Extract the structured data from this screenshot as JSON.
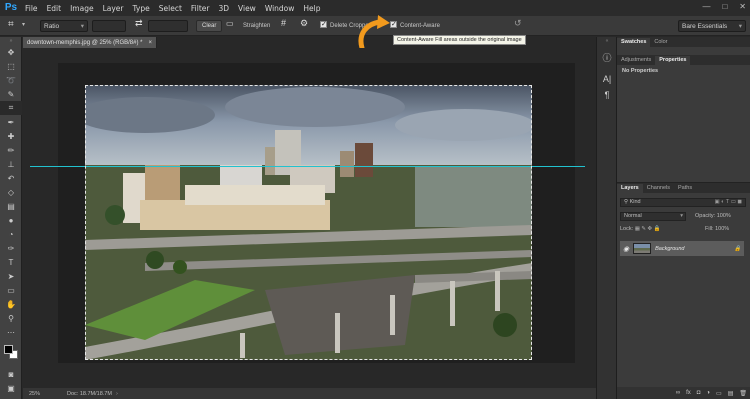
{
  "app": {
    "logo_text": "Ps"
  },
  "menu": [
    "File",
    "Edit",
    "Image",
    "Layer",
    "Type",
    "Select",
    "Filter",
    "3D",
    "View",
    "Window",
    "Help"
  ],
  "options": {
    "ratio_value": "Ratio",
    "clear_label": "Clear",
    "straighten_label": "Straighten",
    "delete_cropped_label": "Delete Cropped",
    "content_aware_label": "Content-Aware",
    "workspace_value": "Bare Essentials"
  },
  "tooltip": "Content-Aware Fill areas outside the original image",
  "document": {
    "tab_title": "downtown-memphis.jpg @ 25% (RGB/8#) *",
    "zoom": "25%",
    "doc_info": "Doc: 18.7M/18.7M"
  },
  "panels": {
    "top_tabs": [
      "Swatches",
      "Color"
    ],
    "sub_tabs": [
      "Adjustments",
      "Properties"
    ],
    "properties_text": "No Properties",
    "layers_tabs": [
      "Layers",
      "Channels",
      "Paths"
    ],
    "kind_label": "Kind",
    "blend_mode": "Normal",
    "opacity_label": "Opacity:",
    "opacity_value": "100%",
    "lock_label": "Lock:",
    "fill_label": "Fill:",
    "fill_value": "100%",
    "layer_name": "Background"
  },
  "colors": {
    "accent_arrow": "#f29a1d",
    "guide": "#22c2cf"
  }
}
